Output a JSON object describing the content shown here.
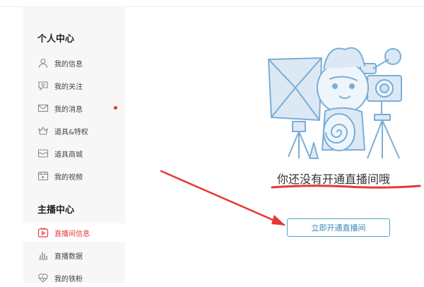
{
  "sidebar": {
    "section_personal": "个人中心",
    "personal_items": [
      {
        "label": "我的信息",
        "icon": "user-icon"
      },
      {
        "label": "我的关注",
        "icon": "heart-chat-icon"
      },
      {
        "label": "我的消息",
        "icon": "mail-icon",
        "unread": true
      },
      {
        "label": "道具&特权",
        "icon": "crown-icon"
      },
      {
        "label": "道具商城",
        "icon": "shop-icon"
      },
      {
        "label": "我的视频",
        "icon": "video-icon"
      }
    ],
    "section_streamer": "主播中心",
    "streamer_items": [
      {
        "label": "直播间信息",
        "icon": "play-tv-icon",
        "active": true
      },
      {
        "label": "直播数据",
        "icon": "bar-chart-icon"
      },
      {
        "label": "我的铁粉",
        "icon": "heart-pulse-icon"
      }
    ]
  },
  "main": {
    "empty_message": "你还没有开通直播间哦",
    "open_button_label": "立即开通直播间"
  },
  "colors": {
    "accent_red": "#e53935",
    "button_border": "#5aa6c3",
    "illustration": "#7aaed6"
  }
}
